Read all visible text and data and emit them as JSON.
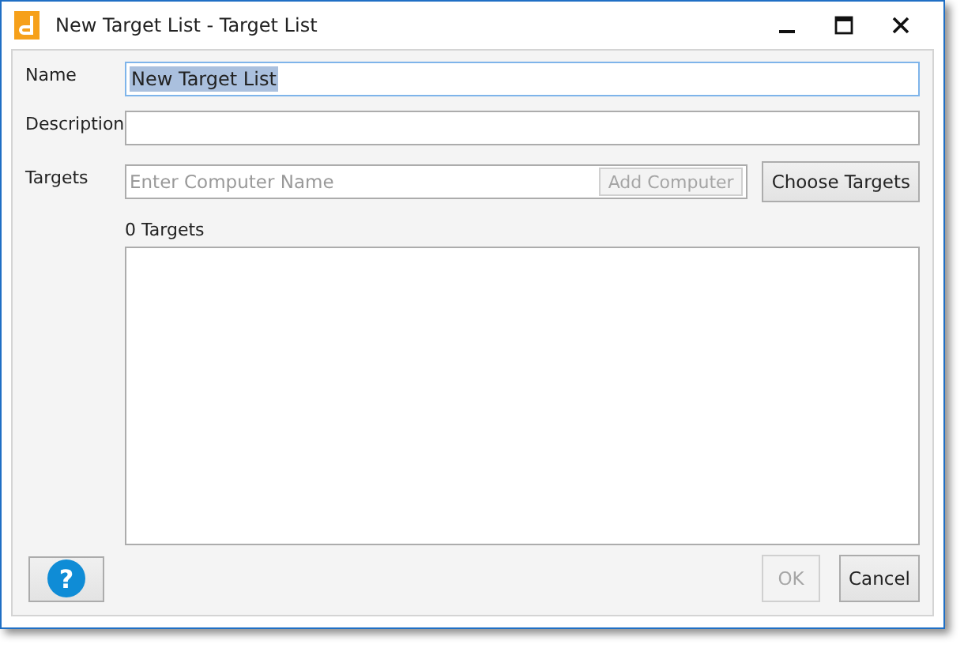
{
  "window": {
    "title": "New Target List - Target List"
  },
  "fields": [
    {
      "label": "Name",
      "value": "New Target List",
      "text_selected": true
    },
    {
      "label": "Description"
    }
  ],
  "targets": {
    "label": "Targets",
    "placeholder": "Enter Computer Name",
    "add_button": {
      "label": "Add Computer",
      "disabled": true
    },
    "choose_button": {
      "label": "Choose Targets",
      "disabled": false
    },
    "count": "0 Targets"
  },
  "help_button": {
    "label": "?"
  },
  "buttons": [
    {
      "label": "OK",
      "disabled": true
    },
    {
      "label": "Cancel",
      "disabled": false
    }
  ]
}
